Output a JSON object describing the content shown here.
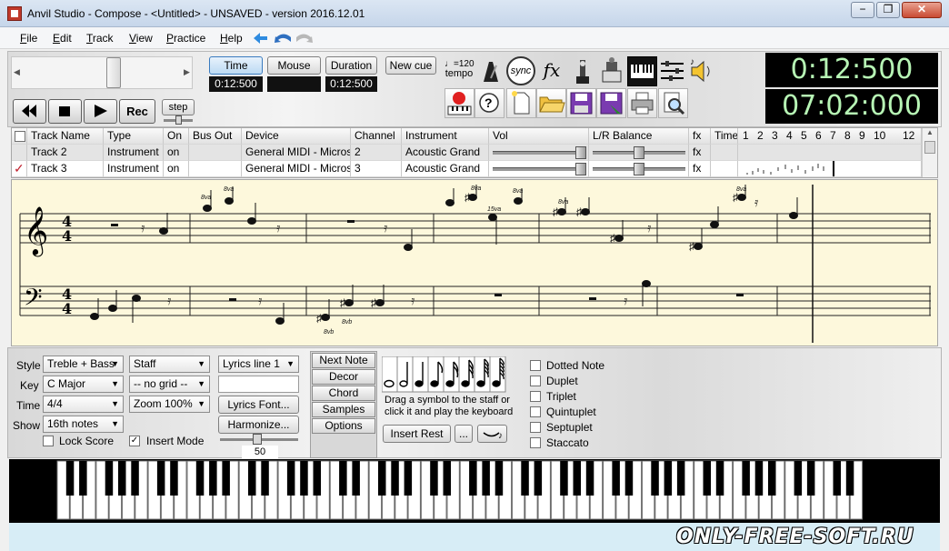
{
  "window": {
    "title": "Anvil Studio - Compose - <Untitled> - UNSAVED - version 2016.12.01",
    "minimize": "−",
    "maximize": "❐",
    "close": "✕"
  },
  "menu": [
    "File",
    "Edit",
    "Track",
    "View",
    "Practice",
    "Help"
  ],
  "toolbar": {
    "time_btn": "Time",
    "mouse_btn": "Mouse",
    "duration_btn": "Duration",
    "newcue_btn": "New cue",
    "time_value": "0:12:500",
    "mouse_value": "",
    "duration_value": "0:12:500",
    "tempo_value": "♩=120",
    "tempo_label": "tempo",
    "sync_label": "sync",
    "fx_label": "fx",
    "rec_label": "Rec",
    "step_label": "step",
    "lcd_time": "0:12:500",
    "lcd_clock": "07:02:000",
    "icons": [
      "metronome-icon",
      "sync-icon",
      "fx-icon",
      "mixer-icon",
      "band-icon",
      "keyboard-icon",
      "sliders-icon",
      "speaker-icon",
      "record-piano-icon",
      "help-icon",
      "new-file-icon",
      "open-folder-icon",
      "save-icon",
      "save-as-icon",
      "print-icon",
      "zoom-icon"
    ]
  },
  "tracks": {
    "headers": [
      "Track Name",
      "Type",
      "On",
      "Bus Out",
      "Device",
      "Channel",
      "Instrument",
      "Vol",
      "L/R Balance",
      "fx",
      "Time"
    ],
    "time_ruler": [
      "1",
      "2",
      "3",
      "4",
      "5",
      "6",
      "7",
      "8",
      "9",
      "10",
      "12"
    ],
    "rows": [
      {
        "checked": "",
        "name": "Track 2",
        "type": "Instrument",
        "on": "on",
        "bus": "",
        "device": "General MIDI - Microso",
        "channel": "2",
        "instrument": "Acoustic Grand",
        "fx": "fx"
      },
      {
        "checked": "✓",
        "name": "Track 3",
        "type": "Instrument",
        "on": "on",
        "bus": "",
        "device": "General MIDI - Microso",
        "channel": "3",
        "instrument": "Acoustic Grand",
        "fx": "fx"
      }
    ]
  },
  "staff": {
    "treble_time": "4/4",
    "bass_time": "4/4",
    "ottava_marks": [
      "8va",
      "8va",
      "8va",
      "8va",
      "15va",
      "8va",
      "8va",
      "8vb",
      "8vb"
    ]
  },
  "panel": {
    "style_label": "Style",
    "style_value": "Treble + Bass",
    "key_label": "Key",
    "key_value": "C Major",
    "time_label": "Time",
    "time_value": "4/4",
    "show_label": "Show",
    "show_value": "16th notes",
    "staff_value": "Staff",
    "grid_value": "-- no grid --",
    "zoom_value": "Zoom 100%",
    "lyrics_value": "Lyrics line 1",
    "lyrics_font_btn": "Lyrics Font...",
    "harmonize_btn": "Harmonize...",
    "slider_value": "50",
    "lock_score": "Lock Score",
    "insert_mode": "Insert Mode",
    "side_buttons": [
      "Next Note",
      "Decor",
      "Chord",
      "Samples",
      "Options"
    ],
    "hint": "Drag a symbol to the staff or click it and play the keyboard",
    "insert_rest_btn": "Insert Rest",
    "more_btn": "...",
    "note_options": [
      "Dotted Note",
      "Duplet",
      "Triplet",
      "Quintuplet",
      "Septuplet",
      "Staccato"
    ]
  },
  "watermark": "ONLY-FREE-SOFT.RU"
}
